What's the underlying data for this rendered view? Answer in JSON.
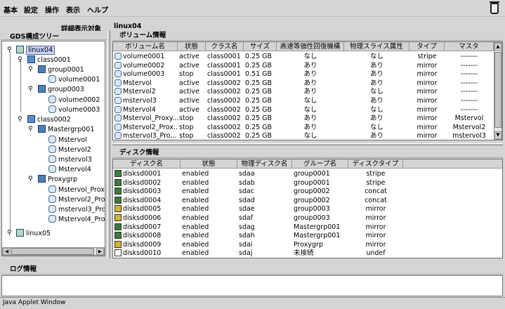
{
  "menu": {
    "items": [
      "基本",
      "設定",
      "操作",
      "表示",
      "ヘルプ"
    ]
  },
  "toolbar": {
    "detail_label": "詳細表示対象"
  },
  "left_panel": {
    "title": "GDS構成ツリー",
    "tree": {
      "host1": "linux04",
      "class1": "class0001",
      "group1": "group0001",
      "vol1": "volume0001",
      "group3": "group0003",
      "vol2": "volume0002",
      "vol3": "volume0003",
      "class2": "class0002",
      "mastergrp": "Mastergrp001",
      "mvol1": "Mstervol",
      "mvol2": "Mstervol2",
      "mvol3": "mstervol3",
      "mvol4": "Mstervol4",
      "proxygrp": "Proxygrp",
      "pvol1": "Mstervol_Proxy",
      "pvol2": "Mstervol2_Pro",
      "pvol3": "mstervol3_Pro",
      "pvol4": "Mstervol4_Pro",
      "host2": "linux05"
    }
  },
  "right_panel": {
    "host_label": "linux04",
    "volume_panel": {
      "title": "ボリューム情報",
      "columns": [
        "ボリューム名",
        "状態",
        "クラス名",
        "サイズ",
        "高速等価性回復機構",
        "物理スライス属性",
        "タイプ",
        "マスタ"
      ],
      "rows": [
        [
          "volume0001",
          "active",
          "class0001",
          "0.25 GB",
          "なし",
          "なし",
          "stripe",
          "-------"
        ],
        [
          "volume0002",
          "active",
          "class0001",
          "0.25 GB",
          "あり",
          "あり",
          "mirror",
          "-------"
        ],
        [
          "volume0003",
          "stop",
          "class0001",
          "0.51 GB",
          "あり",
          "あり",
          "mirror",
          "-------"
        ],
        [
          "Mstervol",
          "active",
          "class0002",
          "0.25 GB",
          "あり",
          "あり",
          "mirror",
          "-------"
        ],
        [
          "Mstervol2",
          "active",
          "class0002",
          "0.25 GB",
          "あり",
          "なし",
          "mirror",
          "-------"
        ],
        [
          "mstervol3",
          "active",
          "class0002",
          "0.25 GB",
          "なし",
          "あり",
          "mirror",
          "-------"
        ],
        [
          "Mstervol4",
          "active",
          "class0002",
          "0.25 GB",
          "なし",
          "なし",
          "mirror",
          "-------"
        ],
        [
          "Mstervol_Proxy...",
          "stop",
          "class0002",
          "0.25 GB",
          "あり",
          "あり",
          "mirror",
          "Mstervol"
        ],
        [
          "Mstervol2_Prox...",
          "stop",
          "class0002",
          "0.25 GB",
          "あり",
          "なし",
          "mirror",
          "Mstervol2"
        ],
        [
          "mstervol3_Pro...",
          "stop",
          "class0002",
          "0.25 GB",
          "なし",
          "あり",
          "mirror",
          "mstervol3"
        ]
      ]
    },
    "disk_panel": {
      "title": "ディスク情報",
      "columns": [
        "ディスク名",
        "状態",
        "物理ディスク名",
        "グループ名",
        "ディスクタイプ"
      ],
      "rows": [
        [
          "disksd0001",
          "enabled",
          "sdaa",
          "group0001",
          "stripe"
        ],
        [
          "disksd0002",
          "enabled",
          "sdab",
          "group0001",
          "stripe"
        ],
        [
          "disksd0003",
          "enabled",
          "sdac",
          "group0002",
          "concat"
        ],
        [
          "disksd0004",
          "enabled",
          "sdad",
          "group0002",
          "concat"
        ],
        [
          "disksd0005",
          "enabled",
          "sdae",
          "group0003",
          "mirror"
        ],
        [
          "disksd0006",
          "enabled",
          "sdaf",
          "group0003",
          "mirror"
        ],
        [
          "disksd0007",
          "enabled",
          "sdag",
          "Mastergrp001",
          "mirror"
        ],
        [
          "disksd0008",
          "enabled",
          "sdah",
          "Mastergrp001",
          "mirror"
        ],
        [
          "disksd0009",
          "enabled",
          "sdai",
          "Proxygrp",
          "mirror"
        ],
        [
          "disksd0010",
          "enabled",
          "sdaj",
          "未接続",
          "undef"
        ]
      ],
      "row_icon_colors": [
        "#3a7c3a",
        "#3a7c3a",
        "#3a7c3a",
        "#3a7c3a",
        "#d6b42c",
        "#d6b42c",
        "#3a7c3a",
        "#3a7c3a",
        "#d6b42c",
        "#ffffff"
      ]
    }
  },
  "log": {
    "title": "ログ情報"
  },
  "status_bar": {
    "text": "Java Applet Window"
  }
}
